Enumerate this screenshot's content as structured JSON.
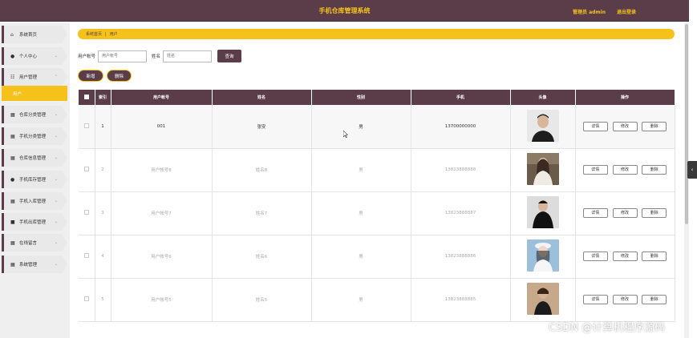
{
  "header": {
    "title": "手机仓库管理系统",
    "admin_label": "管理员 admin",
    "logout_label": "退出登录"
  },
  "sidebar": {
    "items": [
      {
        "label": "系统首页",
        "icon": "home-icon"
      },
      {
        "label": "个人中心",
        "icon": "user-icon"
      },
      {
        "label": "用户管理",
        "icon": "user-manage-icon"
      },
      {
        "label": "仓库分类管理",
        "icon": "grid-icon"
      },
      {
        "label": "手机分类管理",
        "icon": "grid-icon"
      },
      {
        "label": "仓库信息管理",
        "icon": "grid-icon"
      },
      {
        "label": "手机库存管理",
        "icon": "user-icon"
      },
      {
        "label": "手机入库管理",
        "icon": "grid-icon"
      },
      {
        "label": "手机出库管理",
        "icon": "box-icon"
      },
      {
        "label": "在线留言",
        "icon": "grid-icon"
      },
      {
        "label": "系统管理",
        "icon": "grid-icon"
      }
    ],
    "submenu_active": "用户"
  },
  "breadcrumb": {
    "home": "系统首页",
    "sep": "|",
    "current": "用户"
  },
  "search": {
    "account_label": "用户帐号",
    "account_placeholder": "用户帐号",
    "name_label": "姓名",
    "name_placeholder": "姓名",
    "search_button": "查询"
  },
  "actions": {
    "add_label": "新增",
    "delete_label": "删除"
  },
  "table": {
    "headers": [
      "索引",
      "用户帐号",
      "姓名",
      "性别",
      "手机",
      "头像",
      "操作"
    ],
    "rows": [
      {
        "index": "1",
        "account": "001",
        "name": "张安",
        "gender": "男",
        "phone": "13700000000"
      },
      {
        "index": "2",
        "account": "用户帐号8",
        "name": "姓名8",
        "gender": "男",
        "phone": "13823888888"
      },
      {
        "index": "3",
        "account": "用户帐号7",
        "name": "姓名7",
        "gender": "男",
        "phone": "13823888887"
      },
      {
        "index": "4",
        "account": "用户帐号6",
        "name": "姓名6",
        "gender": "男",
        "phone": "13823888886"
      },
      {
        "index": "5",
        "account": "用户帐号5",
        "name": "姓名5",
        "gender": "男",
        "phone": "13823888885"
      }
    ],
    "op_detail": "详情",
    "op_edit": "修改",
    "op_delete": "删除"
  },
  "watermark": "CSDN @计算机程序源码",
  "colors": {
    "header_bg": "#5a3d49",
    "accent": "#f5c21b",
    "table_header_bg": "#5a3d49"
  }
}
